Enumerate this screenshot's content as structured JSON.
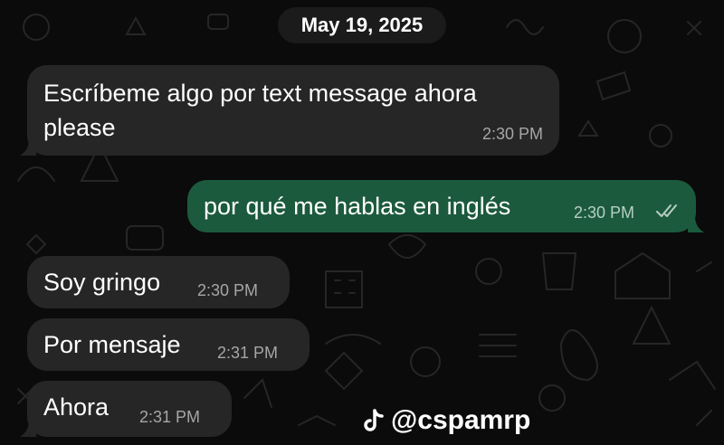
{
  "chat": {
    "date": "May 19, 2025",
    "messages": [
      {
        "direction": "incoming",
        "lines": [
          "Escríbeme algo por text message ahora",
          "please"
        ],
        "time": "2:30 PM"
      },
      {
        "direction": "outgoing",
        "text": "por qué me hablas en inglés",
        "time": "2:30 PM",
        "status": "read-double-check"
      },
      {
        "direction": "incoming",
        "text": "Soy gringo",
        "time": "2:30 PM"
      },
      {
        "direction": "incoming",
        "text": "Por mensaje",
        "time": "2:31 PM"
      },
      {
        "direction": "incoming",
        "text": "Ahora",
        "time": "2:31 PM"
      }
    ]
  },
  "watermark": {
    "icon": "tiktok-icon",
    "handle": "@cspamrp"
  },
  "colors": {
    "background": "#0b0b0b",
    "incoming_bubble": "#262626",
    "outgoing_bubble": "#1c5a3d",
    "timestamp": "#a6a6a6"
  }
}
